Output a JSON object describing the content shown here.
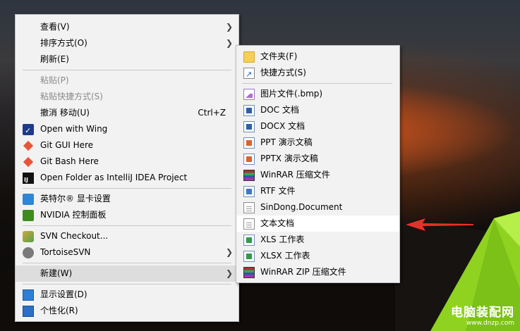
{
  "main_menu": {
    "items": [
      {
        "label": "查看(V)",
        "submenu": true
      },
      {
        "label": "排序方式(O)",
        "submenu": true
      },
      {
        "label": "刷新(E)"
      },
      {
        "label": "粘贴(P)",
        "disabled": true
      },
      {
        "label": "粘贴快捷方式(S)",
        "disabled": true
      },
      {
        "label": "撤消 移动(U)",
        "shortcut": "Ctrl+Z"
      },
      {
        "label": "Open with Wing",
        "icon": "wing-ide-icon"
      },
      {
        "label": "Git GUI Here",
        "icon": "git-icon"
      },
      {
        "label": "Git Bash Here",
        "icon": "git-icon"
      },
      {
        "label": "Open Folder as IntelliJ IDEA Project",
        "icon": "intellij-idea-icon"
      },
      {
        "label": "英特尔® 显卡设置",
        "icon": "intel-graphics-icon"
      },
      {
        "label": "NVIDIA 控制面板",
        "icon": "nvidia-icon"
      },
      {
        "label": "SVN Checkout...",
        "icon": "svn-checkout-icon"
      },
      {
        "label": "TortoiseSVN",
        "icon": "tortoisesvn-icon",
        "submenu": true
      },
      {
        "label": "新建(W)",
        "submenu": true,
        "highlighted": true
      },
      {
        "label": "显示设置(D)",
        "icon": "display-settings-icon"
      },
      {
        "label": "个性化(R)",
        "icon": "personalize-icon"
      }
    ]
  },
  "new_submenu": {
    "items": [
      {
        "label": "文件夹(F)",
        "icon": "folder-icon"
      },
      {
        "label": "快捷方式(S)",
        "icon": "shortcut-icon"
      },
      {
        "label": "图片文件(.bmp)",
        "icon": "bmp-file-icon"
      },
      {
        "label": "DOC 文档",
        "icon": "doc-file-icon"
      },
      {
        "label": "DOCX 文档",
        "icon": "docx-file-icon"
      },
      {
        "label": "PPT 演示文稿",
        "icon": "ppt-file-icon"
      },
      {
        "label": "PPTX 演示文稿",
        "icon": "pptx-file-icon"
      },
      {
        "label": "WinRAR 压缩文件",
        "icon": "winrar-icon"
      },
      {
        "label": "RTF 文件",
        "icon": "rtf-file-icon"
      },
      {
        "label": "SinDong.Document",
        "icon": "blank-file-icon"
      },
      {
        "label": "文本文档",
        "icon": "text-file-icon",
        "highlighted": true
      },
      {
        "label": "XLS 工作表",
        "icon": "xls-file-icon"
      },
      {
        "label": "XLSX 工作表",
        "icon": "xlsx-file-icon"
      },
      {
        "label": "WinRAR ZIP 压缩文件",
        "icon": "winrar-zip-icon"
      }
    ]
  },
  "watermark": {
    "title": "电脑装配网",
    "url": "www.dnzp.com"
  },
  "colors": {
    "menu_bg": "#f2f2f2",
    "hover": "#dddddd",
    "arrow": "#e8302a",
    "tent": "#9ad81e"
  }
}
